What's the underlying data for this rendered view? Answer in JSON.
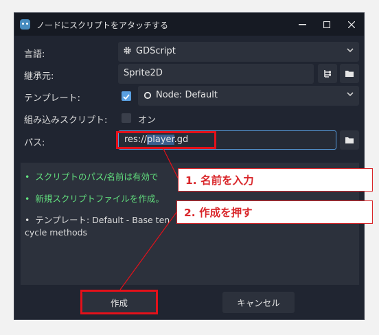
{
  "window": {
    "title": "ノードにスクリプトをアタッチする",
    "app_icon": "godot-icon",
    "buttons": [
      "minimize-icon",
      "maximize-icon",
      "close-icon"
    ]
  },
  "form": {
    "language_label": "言語:",
    "language_value": "GDScript",
    "inherits_label": "継承元:",
    "inherits_value": "Sprite2D",
    "template_label": "テンプレート:",
    "template_checked": true,
    "template_value": "Node: Default",
    "builtin_label": "組み込みスクリプト:",
    "builtin_checked": false,
    "builtin_value": "オン",
    "path_label": "パス:",
    "path_prefix": "res://",
    "path_selected": "player",
    "path_suffix": ".gd"
  },
  "info": {
    "line1_bullet": "•",
    "line1": "スクリプトのパス/名前は有効で",
    "line2_bullet": "•",
    "line2": "新規スクリプトファイルを作成。",
    "line3_bullet": "•",
    "line3": "テンプレート: Default - Base ten",
    "line4": "cycle methods"
  },
  "buttons": {
    "create": "作成",
    "cancel": "キャンセル"
  },
  "annotations": {
    "callout1": "1. 名前を入力",
    "callout2": "2. 作成を押す"
  },
  "colors": {
    "accent": "#478cbf",
    "green_text": "#62e07e",
    "annotation_red": "#e4111a"
  }
}
